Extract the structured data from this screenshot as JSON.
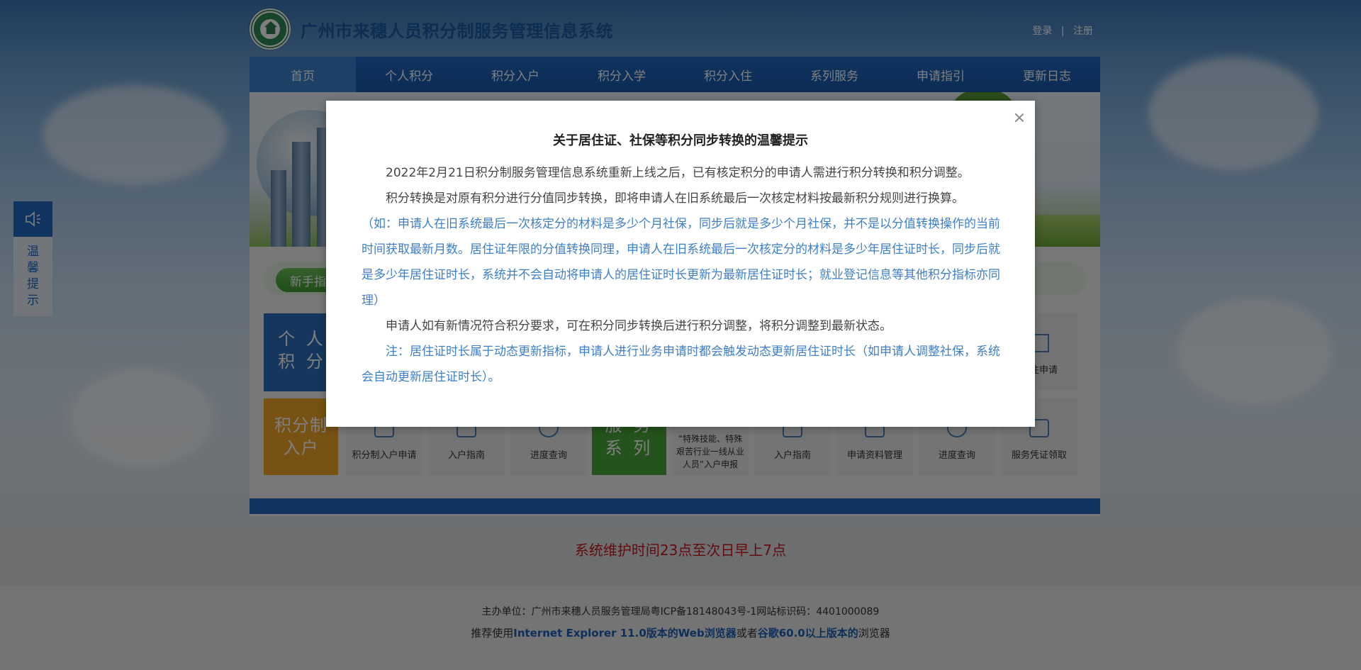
{
  "header": {
    "site_title": "广州市来穗人员积分制服务管理信息系统",
    "login": "登录",
    "separator": "|",
    "register": "注册"
  },
  "nav": {
    "items": [
      {
        "label": "首页"
      },
      {
        "label": "个人积分"
      },
      {
        "label": "积分入户"
      },
      {
        "label": "积分入学"
      },
      {
        "label": "积分入住"
      },
      {
        "label": "系列服务"
      },
      {
        "label": "申请指引"
      },
      {
        "label": "更新日志"
      }
    ]
  },
  "guide": {
    "pill_label": "新手指"
  },
  "blocks": {
    "personal_points": "个 人\n积 分",
    "hukou_points": "积分制\n入户",
    "service_series": "服 务\n系 列"
  },
  "tiles": {
    "hukou_apply": "积分制入户申请",
    "hukou_guide": "入户指南",
    "progress_query_1": "进度查询",
    "special_skill": "“特殊技能、特殊艰苦行业一线从业人员”入户申报",
    "hukou_guide_2": "入户指南",
    "apply_material_mgmt": "申请资料管理",
    "progress_query_2": "进度查询",
    "service_cert": "服务凭证领取",
    "housing_apply": "入住申请"
  },
  "side_widget": {
    "label": "温\n馨\n提\n示"
  },
  "maintenance_notice": "系统维护时间23点至次日早上7点",
  "footer": {
    "line1": "主办单位：广州市来穗人员服务管理局粤ICP备18148043号-1网站标识码：4401000089",
    "line2_prefix": "推荐使用",
    "ie_link": "Internet Explorer 11.0版本的Web浏览器",
    "line2_mid": "或者",
    "chrome_link": "谷歌60.0以上版本的",
    "line2_suffix": "浏览器"
  },
  "modal": {
    "title": "关于居住证、社保等积分同步转换的温馨提示",
    "p1": "2022年2月21日积分制服务管理信息系统重新上线之后，已有核定积分的申请人需进行积分转换和积分调整。",
    "p2": "积分转换是对原有积分进行分值同步转换，即将申请人在旧系统最后一次核定材料按最新积分规则进行换算。",
    "p3": "（如：申请人在旧系统最后一次核定分的材料是多少个月社保，同步后就是多少个月社保，并不是以分值转换操作的当前时间获取最新月数。居住证年限的分值转换同理，申请人在旧系统最后一次核定分的材料是多少年居住证时长，同步后就是多少年居住证时长，系统并不会自动将申请人的居住证时长更新为最新居住证时长；就业登记信息等其他积分指标亦同理）",
    "p4": "申请人如有新情况符合积分要求，可在积分同步转换后进行积分调整，将积分调整到最新状态。",
    "p5": "注：居住证时长属于动态更新指标，申请人进行业务申请时都会触发动态更新居住证时长（如申请人调整社保，系统会自动更新居住证时长）。",
    "accent_color": "#3d7fc9"
  }
}
